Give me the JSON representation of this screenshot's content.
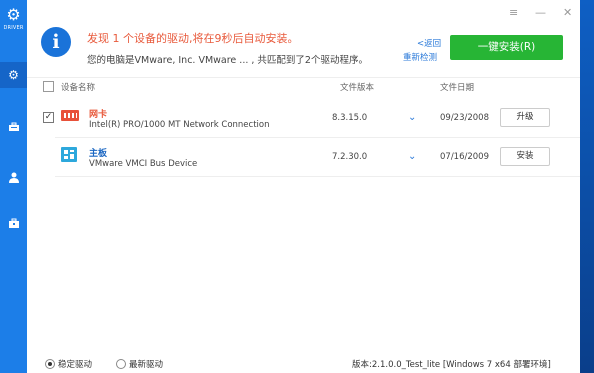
{
  "sidebar": {
    "logo_text": "DRIVER",
    "items": [
      {
        "icon": "gear-icon"
      },
      {
        "icon": "toolbox-icon"
      },
      {
        "icon": "user-icon"
      },
      {
        "icon": "briefcase-icon"
      }
    ]
  },
  "window_controls": {
    "menu": "≡",
    "minimize": "—",
    "close": "✕"
  },
  "header": {
    "title": "发现 1 个设备的驱动,将在9秒后自动安装。",
    "subtitle": "您的电脑是VMware, Inc. VMware ... , 共匹配到了2个驱动程序。",
    "back_link": "<返回",
    "recheck_link": "重新检测",
    "install_all_label": "一键安装(R)"
  },
  "columns": {
    "device_name": "设备名称",
    "file_version": "文件版本",
    "file_date": "文件日期"
  },
  "devices": [
    {
      "name": "网卡",
      "description": "Intel(R) PRO/1000 MT Network Connection",
      "version": "8.3.15.0",
      "date": "09/23/2008",
      "action": "升级",
      "checked": true,
      "icon": "network-card-icon"
    },
    {
      "name": "主板",
      "description": "VMware VMCI Bus Device",
      "version": "7.2.30.0",
      "date": "07/16/2009",
      "action": "安装",
      "checked": false,
      "icon": "motherboard-icon"
    }
  ],
  "footer": {
    "stable_label": "稳定驱动",
    "latest_label": "最新驱动",
    "version_text": "版本:2.1.0.0_Test_lite [Windows 7 x64 部署环境]"
  },
  "colors": {
    "accent_blue": "#1a73d9",
    "sidebar_blue": "#1c7ee8",
    "install_green": "#27b535",
    "warning_red": "#e85a3c"
  }
}
